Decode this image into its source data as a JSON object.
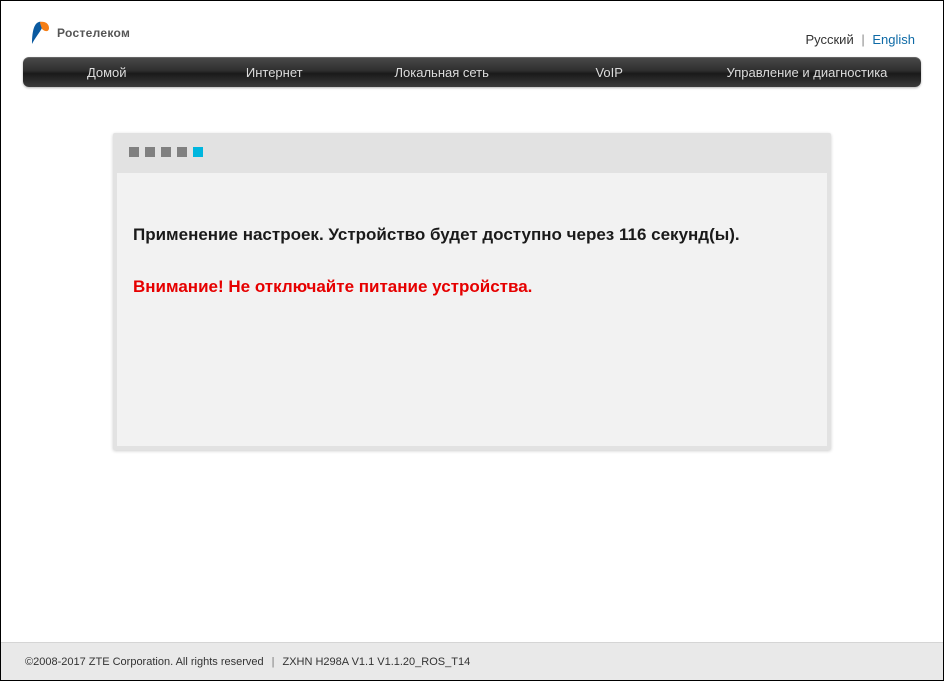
{
  "brand": {
    "name": "Ростелеком"
  },
  "lang": {
    "current": "Русский",
    "separator": "|",
    "other": "English"
  },
  "nav": [
    {
      "id": "home",
      "label": "Домой"
    },
    {
      "id": "inet",
      "label": "Интернет"
    },
    {
      "id": "lan",
      "label": "Локальная сеть"
    },
    {
      "id": "voip",
      "label": "VoIP"
    },
    {
      "id": "mgmt",
      "label": "Управление и диагностика"
    }
  ],
  "progress": {
    "total": 5,
    "active_index": 4
  },
  "status": {
    "prefix": "Применение настроек. Устройство будет доступно через ",
    "seconds": 116,
    "suffix": " секунд(ы)."
  },
  "warning": "Внимание! Не отключайте питание устройства.",
  "footer": {
    "copyright": "©2008-2017 ZTE Corporation. All rights reserved",
    "separator": "|",
    "model": "ZXHN H298A V1.1 V1.1.20_ROS_T14"
  }
}
